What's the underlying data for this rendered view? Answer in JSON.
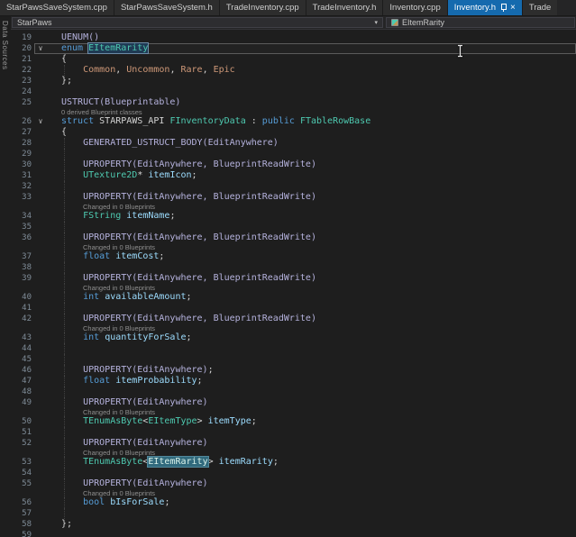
{
  "tabs": [
    {
      "label": "StarPawsSaveSystem.cpp",
      "active": false
    },
    {
      "label": "StarPawsSaveSystem.h",
      "active": false
    },
    {
      "label": "TradeInventory.cpp",
      "active": false
    },
    {
      "label": "TradeInventory.h",
      "active": false
    },
    {
      "label": "Inventory.cpp",
      "active": false
    },
    {
      "label": "Inventory.h",
      "active": true
    },
    {
      "label": "Trade",
      "active": false,
      "partial": true
    }
  ],
  "icons": {
    "close": "×",
    "chevron_down": "▾",
    "pin": "pushpin",
    "enum_symbol": "enum-badge"
  },
  "breadcrumb": {
    "project": "StarPaws",
    "symbol": "EItemRarity"
  },
  "side_tab": {
    "label": "Data Sources"
  },
  "colors": {
    "editor_bg": "#1e1e1e",
    "tab_active_bg": "#156aae",
    "keyword": "#569cd6",
    "type": "#4ec9b0",
    "macro": "#b5b2dd",
    "field": "#9cdcfe",
    "enum_member": "#ce9878",
    "codelens": "#8f8f8f",
    "line_highlight_border": "#5b5b5b",
    "reference_highlight_bg": "#316a7d"
  },
  "editor": {
    "fold_icon": "∨",
    "first_line": 19,
    "last_line": 59,
    "lines": [
      {
        "n": 19,
        "seg": [
          [
            "macro",
            "UENUM()"
          ]
        ]
      },
      {
        "n": 20,
        "fold": true,
        "cur": true,
        "seg": [
          [
            "kw",
            "enum "
          ],
          [
            "hlbox",
            "EItemRarity"
          ]
        ]
      },
      {
        "n": 21,
        "seg": [
          [
            "plain",
            "{"
          ]
        ]
      },
      {
        "n": 22,
        "g": 1,
        "seg": [
          [
            "plain",
            "    "
          ],
          [
            "enum",
            "Common"
          ],
          [
            "plain",
            ", "
          ],
          [
            "enum",
            "Uncommon"
          ],
          [
            "plain",
            ", "
          ],
          [
            "enum",
            "Rare"
          ],
          [
            "plain",
            ", "
          ],
          [
            "enum",
            "Epic"
          ]
        ]
      },
      {
        "n": 23,
        "seg": [
          [
            "plain",
            "};"
          ]
        ]
      },
      {
        "n": 24,
        "seg": []
      },
      {
        "n": 25,
        "seg": [
          [
            "macro",
            "USTRUCT(Blueprintable)"
          ]
        ]
      },
      {
        "n": 26,
        "fold": true,
        "cl": {
          "t": "0 derived Blueprint classes",
          "i": 0
        },
        "seg": [
          [
            "kw",
            "struct "
          ],
          [
            "plain",
            "STARPAWS_API "
          ],
          [
            "type",
            "FInventoryData"
          ],
          [
            "plain",
            " : "
          ],
          [
            "kw",
            "public "
          ],
          [
            "type",
            "FTableRowBase"
          ]
        ]
      },
      {
        "n": 27,
        "seg": [
          [
            "plain",
            "{"
          ]
        ]
      },
      {
        "n": 28,
        "g": 1,
        "seg": [
          [
            "plain",
            "    "
          ],
          [
            "macro",
            "GENERATED_USTRUCT_BODY(EditAnywhere)"
          ]
        ]
      },
      {
        "n": 29,
        "g": 1,
        "seg": []
      },
      {
        "n": 30,
        "g": 1,
        "seg": [
          [
            "plain",
            "    "
          ],
          [
            "macro",
            "UPROPERTY(EditAnywhere, BlueprintReadWrite)"
          ]
        ]
      },
      {
        "n": 31,
        "g": 1,
        "seg": [
          [
            "plain",
            "    "
          ],
          [
            "type",
            "UTexture2D"
          ],
          [
            "plain",
            "* "
          ],
          [
            "field",
            "itemIcon"
          ],
          [
            "plain",
            ";"
          ]
        ]
      },
      {
        "n": 32,
        "g": 1,
        "seg": []
      },
      {
        "n": 33,
        "g": 1,
        "seg": [
          [
            "plain",
            "    "
          ],
          [
            "macro",
            "UPROPERTY(EditAnywhere, BlueprintReadWrite)"
          ]
        ]
      },
      {
        "n": 34,
        "g": 1,
        "cl": {
          "t": "Changed in 0 Blueprints",
          "i": 1
        },
        "seg": [
          [
            "plain",
            "    "
          ],
          [
            "type",
            "FString"
          ],
          [
            "plain",
            " "
          ],
          [
            "field",
            "itemName"
          ],
          [
            "plain",
            ";"
          ]
        ]
      },
      {
        "n": 35,
        "g": 1,
        "seg": []
      },
      {
        "n": 36,
        "g": 1,
        "seg": [
          [
            "plain",
            "    "
          ],
          [
            "macro",
            "UPROPERTY(EditAnywhere, BlueprintReadWrite)"
          ]
        ]
      },
      {
        "n": 37,
        "g": 1,
        "cl": {
          "t": "Changed in 0 Blueprints",
          "i": 1
        },
        "seg": [
          [
            "plain",
            "    "
          ],
          [
            "kw",
            "float"
          ],
          [
            "plain",
            " "
          ],
          [
            "field",
            "itemCost"
          ],
          [
            "plain",
            ";"
          ]
        ]
      },
      {
        "n": 38,
        "g": 1,
        "seg": []
      },
      {
        "n": 39,
        "g": 1,
        "seg": [
          [
            "plain",
            "    "
          ],
          [
            "macro",
            "UPROPERTY(EditAnywhere, BlueprintReadWrite)"
          ]
        ]
      },
      {
        "n": 40,
        "g": 1,
        "cl": {
          "t": "Changed in 0 Blueprints",
          "i": 1
        },
        "seg": [
          [
            "plain",
            "    "
          ],
          [
            "kw",
            "int"
          ],
          [
            "plain",
            " "
          ],
          [
            "field",
            "availableAmount"
          ],
          [
            "plain",
            ";"
          ]
        ]
      },
      {
        "n": 41,
        "g": 1,
        "seg": []
      },
      {
        "n": 42,
        "g": 1,
        "seg": [
          [
            "plain",
            "    "
          ],
          [
            "macro",
            "UPROPERTY(EditAnywhere, BlueprintReadWrite)"
          ]
        ]
      },
      {
        "n": 43,
        "g": 1,
        "cl": {
          "t": "Changed in 0 Blueprints",
          "i": 1
        },
        "seg": [
          [
            "plain",
            "    "
          ],
          [
            "kw",
            "int"
          ],
          [
            "plain",
            " "
          ],
          [
            "field",
            "quantityForSale"
          ],
          [
            "plain",
            ";"
          ]
        ]
      },
      {
        "n": 44,
        "g": 1,
        "seg": []
      },
      {
        "n": 45,
        "g": 1,
        "seg": []
      },
      {
        "n": 46,
        "g": 1,
        "seg": [
          [
            "plain",
            "    "
          ],
          [
            "macro",
            "UPROPERTY(EditAnywhere)"
          ],
          [
            "plain",
            ";"
          ]
        ]
      },
      {
        "n": 47,
        "g": 1,
        "seg": [
          [
            "plain",
            "    "
          ],
          [
            "kw",
            "float"
          ],
          [
            "plain",
            " "
          ],
          [
            "field",
            "itemProbability"
          ],
          [
            "plain",
            ";"
          ]
        ]
      },
      {
        "n": 48,
        "g": 1,
        "seg": []
      },
      {
        "n": 49,
        "g": 1,
        "seg": [
          [
            "plain",
            "    "
          ],
          [
            "macro",
            "UPROPERTY(EditAnywhere)"
          ]
        ]
      },
      {
        "n": 50,
        "g": 1,
        "cl": {
          "t": "Changed in 0 Blueprints",
          "i": 1
        },
        "seg": [
          [
            "plain",
            "    "
          ],
          [
            "type",
            "TEnumAsByte"
          ],
          [
            "plain",
            "<"
          ],
          [
            "type",
            "EItemType"
          ],
          [
            "plain",
            "> "
          ],
          [
            "field",
            "itemType"
          ],
          [
            "plain",
            ";"
          ]
        ]
      },
      {
        "n": 51,
        "g": 1,
        "seg": []
      },
      {
        "n": 52,
        "g": 1,
        "seg": [
          [
            "plain",
            "    "
          ],
          [
            "macro",
            "UPROPERTY(EditAnywhere)"
          ]
        ]
      },
      {
        "n": 53,
        "g": 1,
        "cl": {
          "t": "Changed in 0 Blueprints",
          "i": 1
        },
        "seg": [
          [
            "plain",
            "    "
          ],
          [
            "type",
            "TEnumAsByte"
          ],
          [
            "plain",
            "<"
          ],
          [
            "hlref",
            "EItemRarity"
          ],
          [
            "plain",
            "> "
          ],
          [
            "field",
            "itemRarity"
          ],
          [
            "plain",
            ";"
          ]
        ]
      },
      {
        "n": 54,
        "g": 1,
        "seg": []
      },
      {
        "n": 55,
        "g": 1,
        "seg": [
          [
            "plain",
            "    "
          ],
          [
            "macro",
            "UPROPERTY(EditAnywhere)"
          ]
        ]
      },
      {
        "n": 56,
        "g": 1,
        "cl": {
          "t": "Changed in 0 Blueprints",
          "i": 1
        },
        "seg": [
          [
            "plain",
            "    "
          ],
          [
            "kw",
            "bool"
          ],
          [
            "plain",
            " "
          ],
          [
            "field",
            "bIsForSale"
          ],
          [
            "plain",
            ";"
          ]
        ]
      },
      {
        "n": 57,
        "g": 1,
        "seg": []
      },
      {
        "n": 58,
        "seg": [
          [
            "plain",
            "};"
          ]
        ]
      },
      {
        "n": 59,
        "seg": []
      }
    ]
  }
}
